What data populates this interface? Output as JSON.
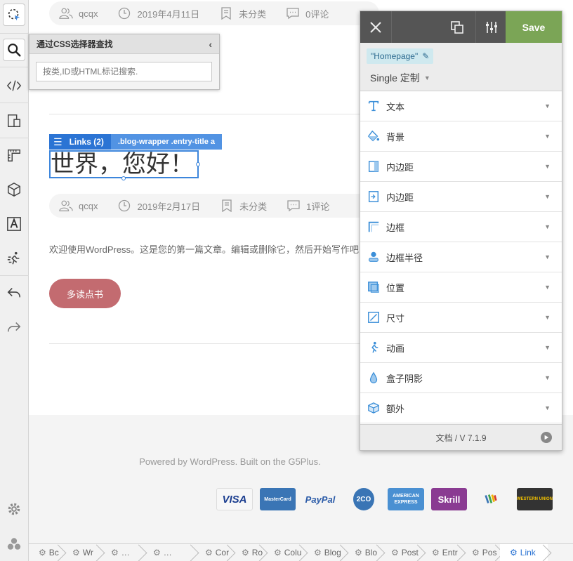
{
  "css_finder": {
    "title": "通过CSS选择器查找",
    "placeholder": "按类,ID或HTML标记搜索."
  },
  "post1_meta": {
    "author": "qcqx",
    "date": "2019年4月11日",
    "category": "未分类",
    "comments": "0评论"
  },
  "post2": {
    "label": "Links (2)",
    "selector": ".blog-wrapper .entry-title a",
    "title": "世界，您好！",
    "meta": {
      "author": "qcqx",
      "date": "2019年2月17日",
      "category": "未分类",
      "comments": "1评论"
    },
    "excerpt": "欢迎使用WordPress。这是您的第一篇文章。编辑或删除它，然后开始写作吧！",
    "read_more": "多读点书"
  },
  "footer": {
    "text": "Powered by WordPress. Built on the G5Plus.",
    "payments": [
      "VISA",
      "MasterCard",
      "PayPal",
      "2CO",
      "AMERICAN EXPRESS",
      "Skrill",
      "Wallet",
      "WESTERN UNION"
    ]
  },
  "panel": {
    "save_label": "Save",
    "context": "\"Homepage\"",
    "mode": "Single 定制",
    "properties": [
      {
        "label": "文本",
        "icon": "text-icon"
      },
      {
        "label": "背景",
        "icon": "background-icon"
      },
      {
        "label": "内边距",
        "icon": "padding-icon"
      },
      {
        "label": "内边距",
        "icon": "margin-icon"
      },
      {
        "label": "边框",
        "icon": "border-icon"
      },
      {
        "label": "边框半径",
        "icon": "border-radius-icon"
      },
      {
        "label": "位置",
        "icon": "position-icon"
      },
      {
        "label": "尺寸",
        "icon": "size-icon"
      },
      {
        "label": "动画",
        "icon": "animation-icon"
      },
      {
        "label": "盒子阴影",
        "icon": "box-shadow-icon"
      },
      {
        "label": "额外",
        "icon": "extra-icon"
      }
    ],
    "footer_text": "文档 / V 7.1.9"
  },
  "breadcrumb": [
    "Bc",
    "Wr",
    "…",
    "…",
    "Cor",
    "Ro",
    "Colu",
    "Blog",
    "Blo",
    "Post",
    "Entr",
    "Pos",
    "Link"
  ],
  "colors": {
    "accent": "#2b74d4",
    "save": "#7ba556",
    "read_more": "#c36b70",
    "toolbar": "#555555"
  }
}
